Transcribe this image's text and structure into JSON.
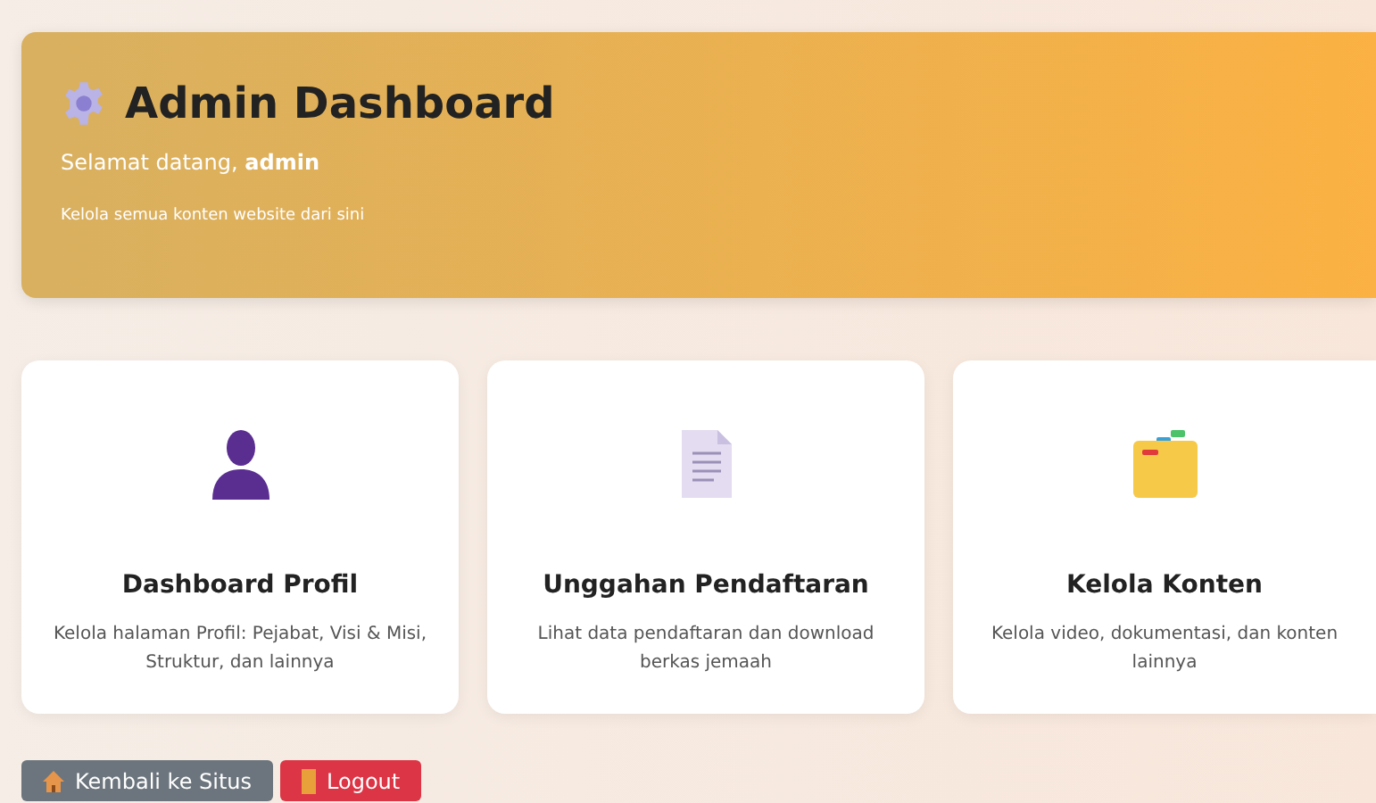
{
  "header": {
    "title": "Admin Dashboard",
    "greeting": "Selamat datang, **admin**",
    "subtitle": "Kelola semua konten website dari sini"
  },
  "cards": [
    {
      "kind": "profile",
      "title": "Dashboard Profil",
      "description": "Kelola halaman Profil: Pejabat, Visi & Misi, Struktur, dan lainnya"
    },
    {
      "kind": "document",
      "title": "Unggahan Pendaftaran",
      "description": "Lihat data pendaftaran dan download berkas jemaah"
    },
    {
      "kind": "folder",
      "title": "Kelola Konten",
      "description": "Kelola video, dokumentasi, dan konten lainnya"
    }
  ],
  "buttons": [
    {
      "kind": "home",
      "label": "Kembali ke Situs"
    },
    {
      "kind": "logout",
      "label": "Logout"
    }
  ]
}
